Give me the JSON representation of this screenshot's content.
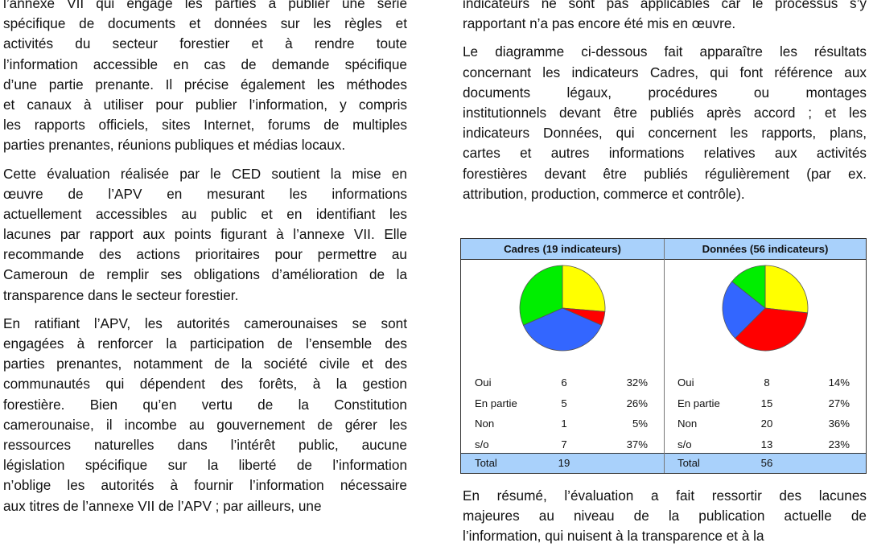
{
  "left_column": {
    "paragraphs": [
      {
        "lines": [
          "l’annexe VII qui engage les parties à publier une série",
          "spécifique de documents et données sur les règles et",
          "activités du secteur forestier et à rendre toute",
          "l’information accessible en cas de demande spécifique",
          "d’une partie prenante. Il précise également les méthodes",
          "et canaux à utiliser pour publier l’information, y compris",
          "les rapports officiels, sites Internet, forums de multiples",
          "parties prenantes, réunions publiques et médias locaux."
        ]
      },
      {
        "lines": [
          "Cette évaluation réalisée par le CED soutient la mise en",
          "œuvre de l’APV en mesurant les informations",
          "actuellement accessibles au public et en identifiant les",
          "lacunes par rapport aux points figurant à l’annexe VII. Elle",
          "recommande des actions prioritaires pour permettre au",
          "Cameroun de remplir ses obligations d’amélioration de la",
          "transparence dans le secteur forestier."
        ]
      },
      {
        "lines": [
          "En ratifiant l’APV, les autorités camerounaises se sont",
          "engagées à renforcer la participation de l’ensemble des",
          "parties prenantes, notamment de la société civile et des",
          "communautés qui dépendent des forêts, à la gestion",
          "forestière. Bien qu’en vertu de la Constitution",
          "camerounaise, il incombe au gouvernement de gérer les",
          "ressources naturelles dans l’intérêt public, aucune",
          "législation spécifique sur la liberté de l’information",
          "n’oblige les autorités à fournir l’information nécessaire",
          "aux titres de l’annexe VII de l’APV ; par ailleurs, une"
        ]
      }
    ]
  },
  "right_column": {
    "paragraphs_top": [
      {
        "lines": [
          "indicateurs ne sont pas applicables car le processus s’y",
          "rapportant n’a pas encore été mis en œuvre."
        ]
      },
      {
        "lines": [
          "Le diagramme ci-dessous fait apparaître les résultats",
          "concernant les indicateurs Cadres, qui font référence aux",
          "documents légaux, procédures ou montages",
          "institutionnels devant  être publiés après accord ; et les",
          "indicateurs Données, qui concernent les rapports, plans,",
          "cartes et autres informations relatives aux activités",
          "forestières devant être publiés régulièrement (par ex.",
          "attribution, production, commerce et contrôle)."
        ]
      }
    ],
    "paragraphs_bottom": [
      {
        "lines": [
          "En résumé, l’évaluation a fait ressortir des lacunes",
          "majeures au niveau de la publication actuelle de",
          "l’information, qui nuisent à la transparence et à la"
        ]
      }
    ]
  },
  "colors": {
    "header_bg": "#a9d1fb",
    "oui": "#00ee00",
    "en_partie": "#ffff00",
    "non": "#ff0000",
    "s_o": "#3366ff"
  },
  "chart_data": [
    {
      "type": "pie",
      "title": "Cadres (19 indicateurs)",
      "categories": [
        "En partie",
        "Non",
        "s/o",
        "Oui"
      ],
      "values": [
        5,
        1,
        7,
        6
      ],
      "colors": [
        "#ffff00",
        "#ff0000",
        "#3366ff",
        "#00ee00"
      ],
      "start": "top",
      "direction": "clockwise",
      "table": {
        "rows": [
          {
            "label": "Oui",
            "count": "6",
            "pct": "32%"
          },
          {
            "label": "En partie",
            "count": "5",
            "pct": "26%"
          },
          {
            "label": "Non",
            "count": "1",
            "pct": "5%"
          },
          {
            "label": "s/o",
            "count": "7",
            "pct": "37%"
          }
        ],
        "total_label": "Total",
        "total": "19"
      }
    },
    {
      "type": "pie",
      "title": "Données (56 indicateurs)",
      "categories": [
        "En partie",
        "Non",
        "s/o",
        "Oui"
      ],
      "values": [
        15,
        20,
        13,
        8
      ],
      "colors": [
        "#ffff00",
        "#ff0000",
        "#3366ff",
        "#00ee00"
      ],
      "start": "top",
      "direction": "clockwise",
      "table": {
        "rows": [
          {
            "label": "Oui",
            "count": "8",
            "pct": "14%"
          },
          {
            "label": "En partie",
            "count": "15",
            "pct": "27%"
          },
          {
            "label": "Non",
            "count": "20",
            "pct": "36%"
          },
          {
            "label": "s/o",
            "count": "13",
            "pct": "23%"
          }
        ],
        "total_label": "Total",
        "total": "56"
      }
    }
  ]
}
